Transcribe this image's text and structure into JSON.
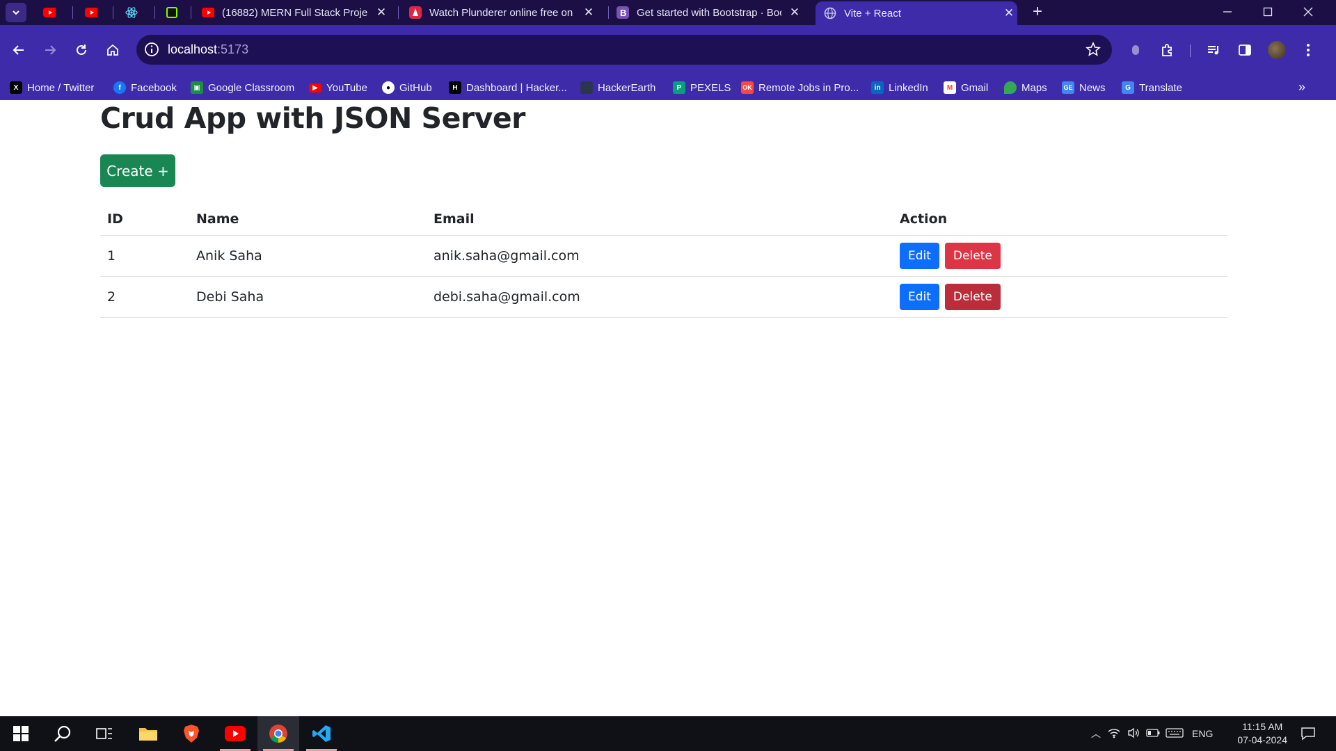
{
  "browser": {
    "tabs": [
      {
        "title": "",
        "icon": "youtube-icon"
      },
      {
        "title": "",
        "icon": "youtube-icon"
      },
      {
        "title": "",
        "icon": "react-icon"
      },
      {
        "title": "",
        "icon": "app-icon"
      },
      {
        "title": "(16882) MERN Full Stack Projec",
        "icon": "youtube-icon"
      },
      {
        "title": "Watch Plunderer online free on",
        "icon": "anime-icon"
      },
      {
        "title": "Get started with Bootstrap · Boo",
        "icon": "bootstrap-icon"
      },
      {
        "title": "Vite + React",
        "icon": "globe-icon",
        "active": true
      }
    ],
    "url_host": "localhost",
    "url_port": ":5173",
    "bookmarks": [
      {
        "label": "Home / Twitter",
        "icon": "x-icon"
      },
      {
        "label": "Facebook",
        "icon": "facebook-icon"
      },
      {
        "label": "Google Classroom",
        "icon": "classroom-icon"
      },
      {
        "label": "YouTube",
        "icon": "youtube-icon"
      },
      {
        "label": "GitHub",
        "icon": "github-icon"
      },
      {
        "label": "Dashboard | Hacker...",
        "icon": "hackerrank-icon"
      },
      {
        "label": "HackerEarth",
        "icon": "hackerearth-icon"
      },
      {
        "label": "PEXELS",
        "icon": "pexels-icon"
      },
      {
        "label": "Remote Jobs in Pro...",
        "icon": "remoteok-icon"
      },
      {
        "label": "LinkedIn",
        "icon": "linkedin-icon"
      },
      {
        "label": "Gmail",
        "icon": "gmail-icon"
      },
      {
        "label": "Maps",
        "icon": "maps-icon"
      },
      {
        "label": "News",
        "icon": "news-icon"
      },
      {
        "label": "Translate",
        "icon": "translate-icon"
      }
    ]
  },
  "app": {
    "title": "Crud App with JSON Server",
    "create_label": "Create +",
    "columns": [
      "ID",
      "Name",
      "Email",
      "Action"
    ],
    "rows": [
      {
        "id": "1",
        "name": "Anik Saha",
        "email": "anik.saha@gmail.com"
      },
      {
        "id": "2",
        "name": "Debi Saha",
        "email": "debi.saha@gmail.com"
      }
    ],
    "edit_label": "Edit",
    "delete_label": "Delete"
  },
  "taskbar": {
    "lang": "ENG",
    "time": "11:15 AM",
    "date": "07-04-2024"
  },
  "colors": {
    "tab_strip": "#1c0f45",
    "toolbar": "#3e2baa",
    "create_button": "#198754",
    "edit_button": "#0d6efd",
    "delete_button": "#dc3545"
  }
}
